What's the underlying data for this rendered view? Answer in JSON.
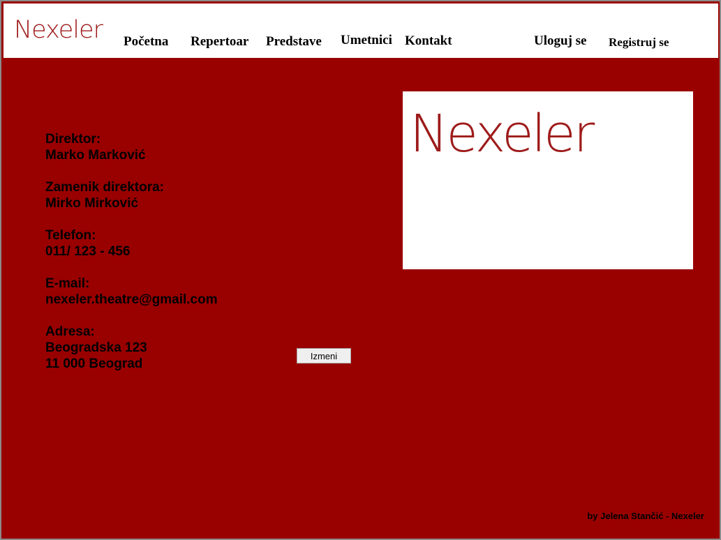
{
  "header": {
    "logo_text": "Nexeler",
    "nav": [
      "Početna",
      "Repertoar",
      "Predstave",
      "Umetnici",
      "Kontakt"
    ],
    "login_label": "Uloguj se",
    "register_label": "Registruj se"
  },
  "contact": {
    "director_label": "Direktor:",
    "director_value": "Marko Marković",
    "deputy_label": "Zamenik direktora:",
    "deputy_value": "Mirko Mirković",
    "phone_label": "Telefon:",
    "phone_value": "011/ 123 - 456",
    "email_label": "E-mail:",
    "email_value": "nexeler.theatre@gmail.com",
    "address_label": "Adresa:",
    "address_line1": "Beogradska 123",
    "address_line2": "11 000 Beograd"
  },
  "logo_box": {
    "text": "Nexeler"
  },
  "edit_button_label": "Izmeni",
  "footer_text": "by Jelena Stančić - Nexeler",
  "colors": {
    "background": "#990000",
    "header_bg": "#ffffff",
    "logo": "#9e1b1b",
    "text": "#000000"
  }
}
